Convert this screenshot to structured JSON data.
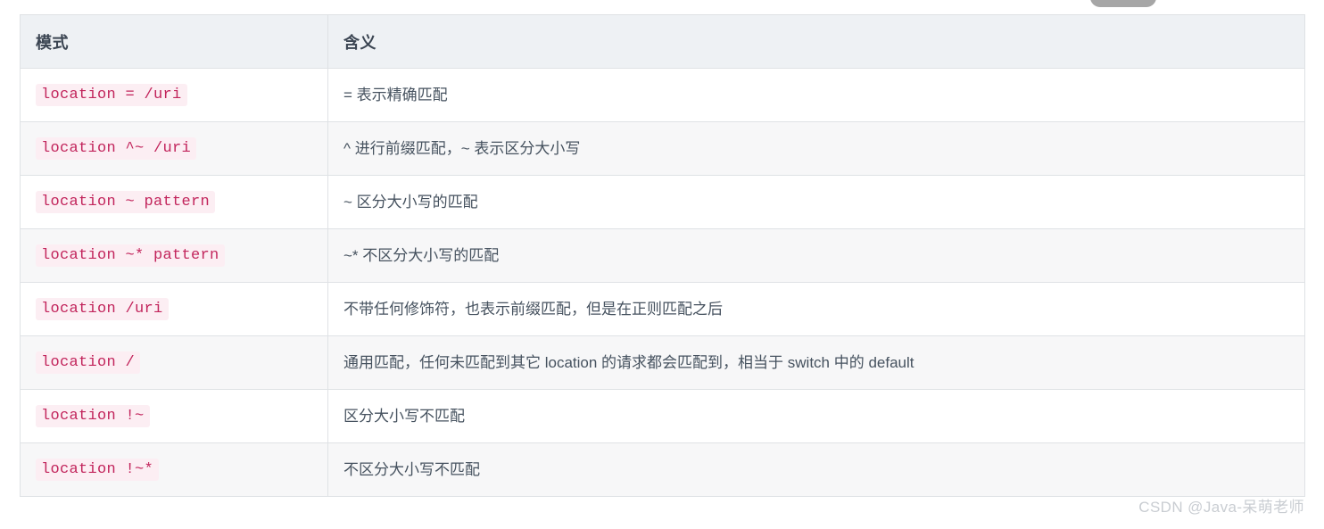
{
  "page": {
    "background_color": "#ffffff",
    "watermark": "CSDN @Java-呆萌老师"
  },
  "decor": {
    "top_pill_color": "#a6a6a6"
  },
  "table": {
    "header_background": "#eef1f4",
    "header_text_color": "#3b4552",
    "border_color": "#dfe2e5",
    "code_text_color": "#c2255c",
    "code_background": "#fceef3",
    "meaning_text_color": "#46525f",
    "stripe_color": "#f7f7f8",
    "columns": [
      "模式",
      "含义"
    ],
    "rows": [
      {
        "mode": "location = /uri",
        "meaning": "= 表示精确匹配"
      },
      {
        "mode": "location ^~ /uri",
        "meaning": "^ 进行前缀匹配，~ 表示区分大小写"
      },
      {
        "mode": "location ~ pattern",
        "meaning": "~ 区分大小写的匹配"
      },
      {
        "mode": "location ~* pattern",
        "meaning": "~* 不区分大小写的匹配"
      },
      {
        "mode": "location /uri",
        "meaning": "不带任何修饰符，也表示前缀匹配，但是在正则匹配之后"
      },
      {
        "mode": "location /",
        "meaning": "通用匹配，任何未匹配到其它 location 的请求都会匹配到，相当于 switch 中的 default"
      },
      {
        "mode": "location !~",
        "meaning": "区分大小写不匹配"
      },
      {
        "mode": "location !~*",
        "meaning": "不区分大小写不匹配"
      }
    ]
  }
}
